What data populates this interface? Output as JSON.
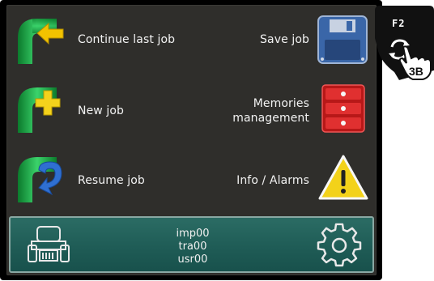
{
  "menu": {
    "continue_label": "Continue last job",
    "new_label": "New job",
    "resume_label": "Resume job",
    "save_label": "Save job",
    "memories_line1": "Memories",
    "memories_line2": "management",
    "info_label": "Info / Alarms"
  },
  "status": {
    "line1": "imp00",
    "line2": "tra00",
    "line3": "usr00"
  },
  "hardkey": {
    "label": "F2",
    "badge": "3B"
  },
  "icons": {
    "continue": "pipe-arrow-left-icon",
    "new": "pipe-plus-icon",
    "resume": "pipe-undo-arrow-icon",
    "save": "floppy-disk-icon",
    "memories": "storage-cabinet-icon",
    "info": "warning-triangle-icon",
    "tractor": "tractor-icon",
    "settings": "gear-icon",
    "rotate": "rotate-arrows-icon",
    "hand": "pointing-hand-icon"
  },
  "colors": {
    "panel": "#2f2e2b",
    "status_bar": "#1f5c56",
    "pipe_green": "#2aa84a",
    "arrow_yellow": "#f2c200",
    "plus_yellow": "#f4d21c",
    "undo_blue": "#2f6fd1",
    "memory_red": "#c81e1e",
    "warning_yellow": "#f3d21a"
  }
}
